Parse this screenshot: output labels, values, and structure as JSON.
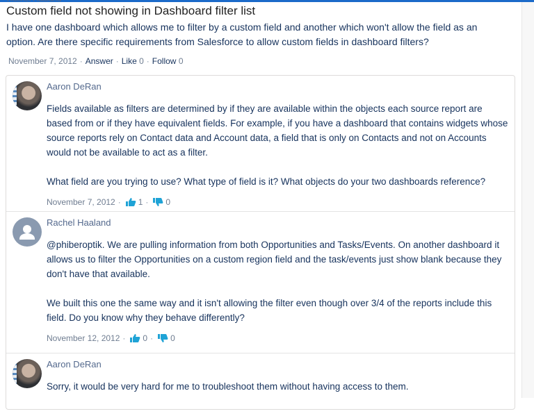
{
  "colors": {
    "accent": "#1b6ac9",
    "thumb": "#1fa3d6",
    "text": "#16325c",
    "meta": "#6f7d91"
  },
  "clipped_header": "Rachel Haaland",
  "question": {
    "title": "Custom field not showing in Dashboard filter list",
    "body": "I have one dashboard which allows me to filter by a custom field and another which won't allow the field as an option. Are there specific requirements from Salesforce to allow custom fields in dashboard filters?",
    "date": "November 7, 2012",
    "answer_label": "Answer",
    "like_label": "Like",
    "like_count": "0",
    "follow_label": "Follow",
    "follow_count": "0"
  },
  "answers": [
    {
      "author": "Aaron DeRan",
      "avatar": "photo",
      "paragraphs": [
        "Fields available as filters are determined by if they are available within the objects each source report are based from or if they have equivalent fields. For example, if you have a dashboard that contains widgets whose source reports rely on Contact data and Account data, a field that is only on Contacts and not on Accounts would not be available to act as a filter.",
        "What field are you trying to use? What type of field is it? What objects do your two dashboards reference?"
      ],
      "date": "November 7, 2012",
      "upvotes": "1",
      "downvotes": "0"
    },
    {
      "author": "Rachel Haaland",
      "avatar": "default-user-icon",
      "paragraphs": [
        "@phiberoptik. We are pulling information from both Opportunities and Tasks/Events. On another dashboard it allows us to filter the Opportunities on a custom region field and the task/events just show blank because they don't have that available.",
        "We built this one the same way and it isn't allowing the filter even though over 3/4 of the reports include this field. Do you know why they behave differently?"
      ],
      "date": "November 12, 2012",
      "upvotes": "0",
      "downvotes": "0"
    },
    {
      "author": "Aaron DeRan",
      "avatar": "photo",
      "paragraphs": [
        "Sorry, it would be very hard for me to troubleshoot them without having access to them."
      ]
    }
  ]
}
